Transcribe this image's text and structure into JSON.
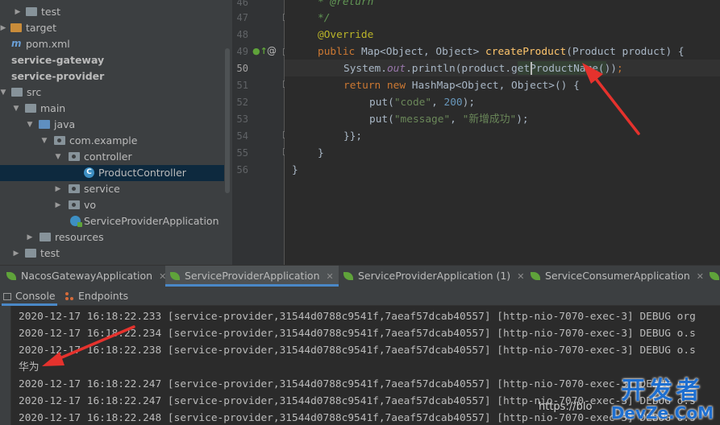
{
  "project_tree": {
    "items": [
      {
        "label": "test",
        "icon": "folder-icon"
      },
      {
        "label": "target",
        "icon": "folder-orange-icon"
      },
      {
        "label": "pom.xml",
        "icon": "maven-icon"
      },
      {
        "label": "service-gateway",
        "icon": "module-icon"
      },
      {
        "label": "service-provider",
        "icon": "module-icon"
      },
      {
        "label": "src",
        "icon": "folder-icon"
      },
      {
        "label": "main",
        "icon": "folder-icon"
      },
      {
        "label": "java",
        "icon": "folder-blue-icon"
      },
      {
        "label": "com.example",
        "icon": "package-icon"
      },
      {
        "label": "controller",
        "icon": "package-icon"
      },
      {
        "label": "ProductController",
        "icon": "class-icon"
      },
      {
        "label": "service",
        "icon": "package-icon"
      },
      {
        "label": "vo",
        "icon": "package-icon"
      },
      {
        "label": "ServiceProviderApplication",
        "icon": "spring-app-icon"
      },
      {
        "label": "resources",
        "icon": "folder-icon"
      },
      {
        "label": "test",
        "icon": "folder-icon"
      }
    ],
    "selected": "ProductController"
  },
  "editor": {
    "line_numbers": [
      "46",
      "47",
      "48",
      "49",
      "50",
      "51",
      "52",
      "53",
      "54",
      "55",
      "56"
    ],
    "current_line": "50",
    "lines": {
      "l46": "* @return",
      "l47": "*/",
      "l48": "@Override",
      "l49_kw": "public",
      "l49_a": " Map<Object, Object> ",
      "l49_fn": "createProduct",
      "l49_b": "(Product product) {",
      "l50_a": "System.",
      "l50_static": "out",
      "l50_b": ".println(product.getProductName())",
      "l50_semi": ";",
      "l51_kw1": "return new",
      "l51_a": " HashMap<Object, Object>() {",
      "l52_a": "put(",
      "l52_str": "\"code\"",
      "l52_comma": ", ",
      "l52_num": "200",
      "l52_b": ");",
      "l53_a": "put(",
      "l53_str1": "\"message\"",
      "l53_comma": ", ",
      "l53_str2": "\"新增成功\"",
      "l53_b": ");",
      "l54": "}};",
      "l55": "}",
      "l56": "}"
    }
  },
  "run_tabs": [
    {
      "label": "NacosGatewayApplication",
      "active": false
    },
    {
      "label": "ServiceProviderApplication",
      "active": true
    },
    {
      "label": "ServiceProviderApplication (1)",
      "active": false
    },
    {
      "label": "ServiceConsumerApplication",
      "active": false
    }
  ],
  "console_tabs": [
    {
      "label": "Console",
      "active": true
    },
    {
      "label": "Endpoints",
      "active": false
    }
  ],
  "console": {
    "lines": [
      "2020-12-17 16:18:22.233 [service-provider,31544d0788c9541f,7aeaf57dcab40557] [http-nio-7070-exec-3] DEBUG org",
      "2020-12-17 16:18:22.234 [service-provider,31544d0788c9541f,7aeaf57dcab40557] [http-nio-7070-exec-3] DEBUG o.s",
      "2020-12-17 16:18:22.238 [service-provider,31544d0788c9541f,7aeaf57dcab40557] [http-nio-7070-exec-3] DEBUG o.s",
      "华为",
      "2020-12-17 16:18:22.247 [service-provider,31544d0788c9541f,7aeaf57dcab40557] [http-nio-7070-exec-3] DEBUG o.s",
      "2020-12-17 16:18:22.247 [service-provider,31544d0788c9541f,7aeaf57dcab40557] [http-nio-7070-exec-3] DEBUG o.s",
      "2020-12-17 16:18:22.248 [service-provider,31544d0788c9541f,7aeaf57dcab40557] [http-nio-7070-exec-3] DEBUG o.s"
    ]
  },
  "watermark": {
    "top": "开发者",
    "bottom": "DevZe.CoM",
    "url": "https://blo"
  },
  "colors": {
    "keyword": "#cc7832",
    "annotation": "#bbb529",
    "method": "#ffc66d",
    "string": "#6a8759",
    "number": "#6897bb",
    "arrow": "#e5322d",
    "watermark": "#1e6fd0"
  }
}
